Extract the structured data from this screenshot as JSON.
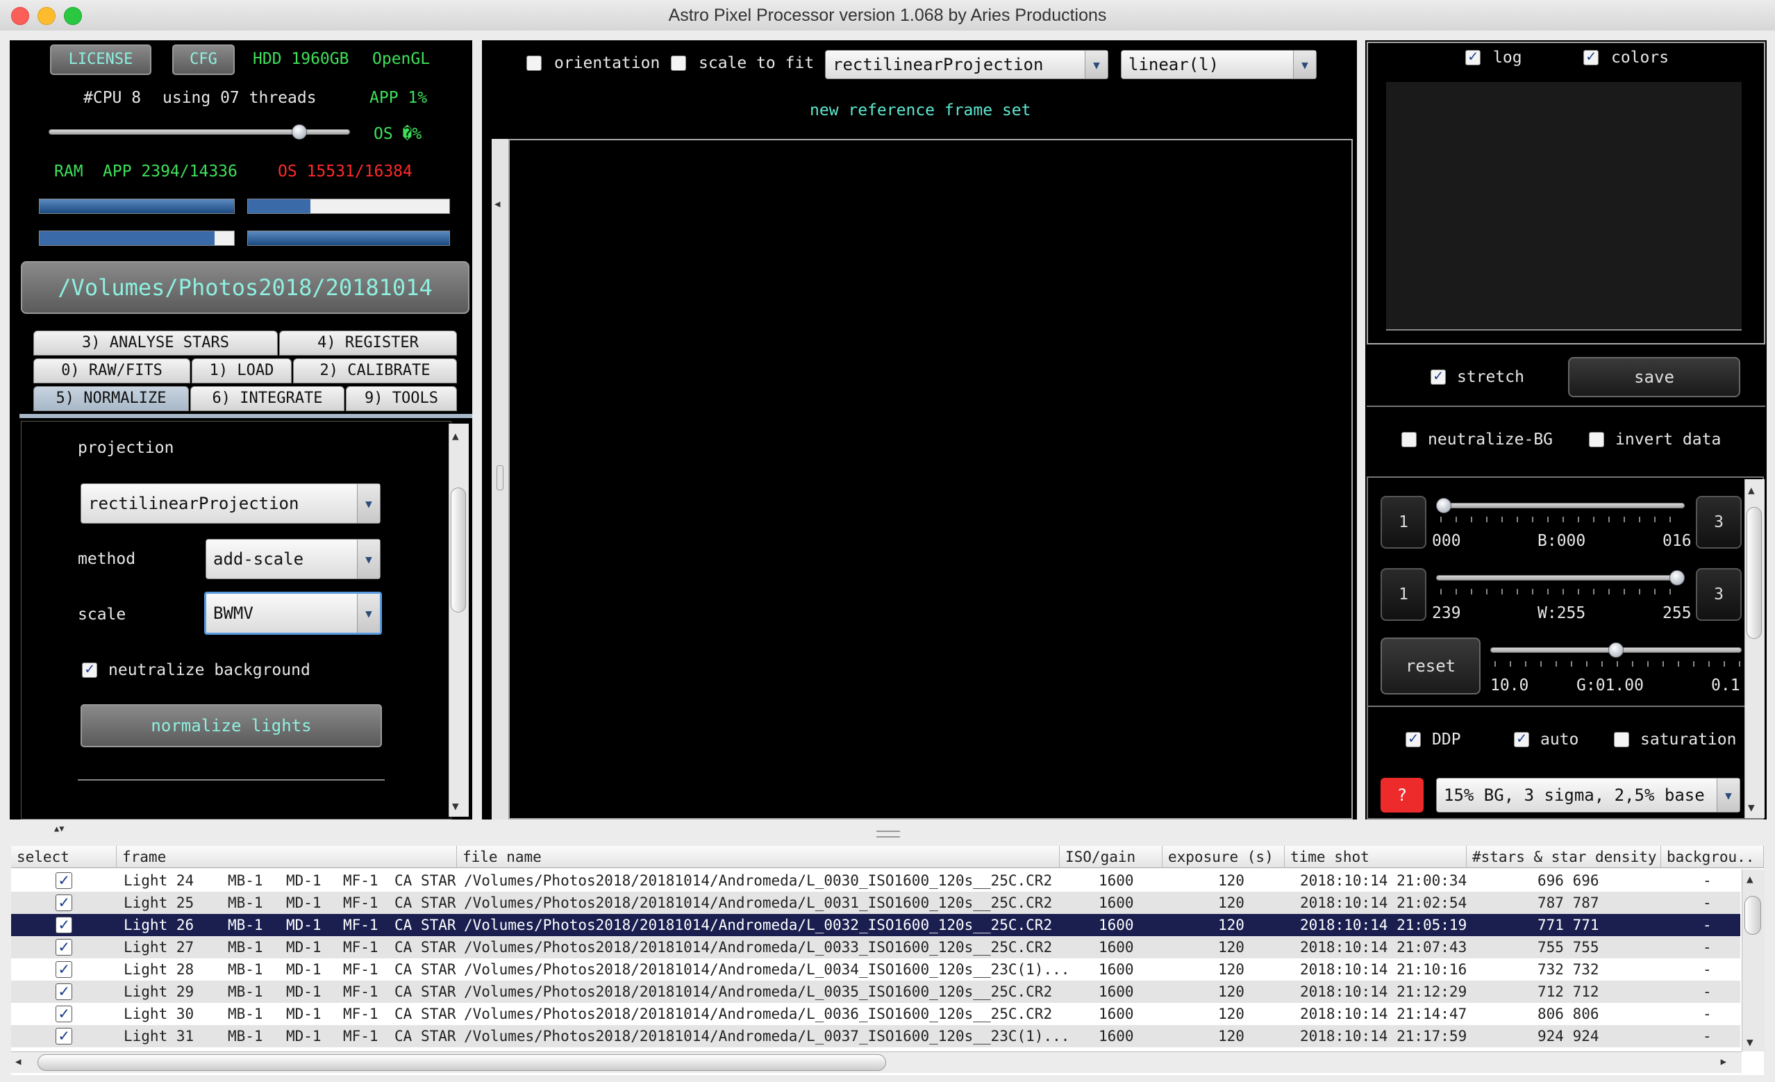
{
  "window": {
    "title": "Astro Pixel Processor version 1.068 by Aries Productions"
  },
  "sysinfo": {
    "license_label": "LICENSE",
    "cfg_label": "CFG",
    "hdd": "HDD 1960GB",
    "opengl": "OpenGL",
    "cpu": "#CPU 8",
    "threads": "using 07 threads",
    "app_cpu": "APP 1%",
    "os_cpu": "OS �%",
    "ram_label": "RAM",
    "ram_app": "APP 2394/14336",
    "ram_os": "OS 15531/16384",
    "thread_slider_fraction": 0.85
  },
  "path_button": "/Volumes/Photos2018/20181014",
  "tabs": [
    {
      "label": "3) ANALYSE STARS",
      "active": false
    },
    {
      "label": "4) REGISTER",
      "active": false
    },
    {
      "label": "0) RAW/FITS",
      "active": false
    },
    {
      "label": "1) LOAD",
      "active": false
    },
    {
      "label": "2) CALIBRATE",
      "active": false
    },
    {
      "label": "5) NORMALIZE",
      "active": true
    },
    {
      "label": "6) INTEGRATE",
      "active": false
    },
    {
      "label": "9) TOOLS",
      "active": false
    }
  ],
  "normalize": {
    "projection_label": "projection",
    "projection_value": "rectilinearProjection",
    "method_label": "method",
    "method_value": "add-scale",
    "scale_label": "scale",
    "scale_value": "BWMV",
    "neutralize_label": "neutralize background",
    "neutralize_checked": true,
    "normalize_button": "normalize lights"
  },
  "viewer": {
    "orientation_label": "orientation",
    "scale_to_fit_label": "scale to fit",
    "projection_value": "rectilinearProjection",
    "stretch_mode_value": "linear(l)",
    "status": "new reference frame set"
  },
  "histogram": {
    "log_label": "log",
    "log_checked": true,
    "colors_label": "colors",
    "colors_checked": true,
    "stretch_label": "stretch",
    "stretch_checked": true,
    "save_label": "save",
    "neutralize_bg_label": "neutralize-BG",
    "invert_label": "invert data"
  },
  "levels": {
    "black": {
      "left_btn": "1",
      "right_btn": "3",
      "min": "000",
      "center": "B:000",
      "max": "016",
      "value_fraction": 0.0
    },
    "white": {
      "left_btn": "1",
      "right_btn": "3",
      "min": "239",
      "center": "W:255",
      "max": "255",
      "value_fraction": 1.0
    },
    "gamma": {
      "reset_label": "reset",
      "min": "10.0",
      "center": "G:01.00",
      "max": "0.1",
      "value_fraction": 0.5
    },
    "ddp_label": "DDP",
    "ddp_checked": true,
    "auto_label": "auto",
    "auto_checked": true,
    "saturation_label": "saturation",
    "saturation_checked": false,
    "help_label": "?",
    "preset_value": "15% BG, 3 sigma, 2,5% base"
  },
  "table": {
    "columns": [
      "select",
      "frame",
      "file name",
      "ISO/gain",
      "exposure (s)",
      "time shot",
      "#stars & star density",
      "backgrou.."
    ],
    "rows": [
      {
        "frame": "Light 24",
        "mb": "MB-1",
        "md": "MD-1",
        "mf": "MF-1",
        "ca": "CA",
        "star": "STAR",
        "file": "/Volumes/Photos2018/20181014/Andromeda/L_0030_ISO1600_120s__25C.CR2",
        "iso": "1600",
        "exp": "120",
        "time": "2018:10:14 21:00:34",
        "stars": "696 696",
        "bg": "-"
      },
      {
        "frame": "Light 25",
        "mb": "MB-1",
        "md": "MD-1",
        "mf": "MF-1",
        "ca": "CA",
        "star": "STAR",
        "file": "/Volumes/Photos2018/20181014/Andromeda/L_0031_ISO1600_120s__25C.CR2",
        "iso": "1600",
        "exp": "120",
        "time": "2018:10:14 21:02:54",
        "stars": "787 787",
        "bg": "-"
      },
      {
        "frame": "Light 26",
        "mb": "MB-1",
        "md": "MD-1",
        "mf": "MF-1",
        "ca": "CA",
        "star": "STAR",
        "file": "/Volumes/Photos2018/20181014/Andromeda/L_0032_ISO1600_120s__25C.CR2",
        "iso": "1600",
        "exp": "120",
        "time": "2018:10:14 21:05:19",
        "stars": "771 771",
        "bg": "-"
      },
      {
        "frame": "Light 27",
        "mb": "MB-1",
        "md": "MD-1",
        "mf": "MF-1",
        "ca": "CA",
        "star": "STAR",
        "file": "/Volumes/Photos2018/20181014/Andromeda/L_0033_ISO1600_120s__25C.CR2",
        "iso": "1600",
        "exp": "120",
        "time": "2018:10:14 21:07:43",
        "stars": "755 755",
        "bg": "-"
      },
      {
        "frame": "Light 28",
        "mb": "MB-1",
        "md": "MD-1",
        "mf": "MF-1",
        "ca": "CA",
        "star": "STAR",
        "file": "/Volumes/Photos2018/20181014/Andromeda/L_0034_ISO1600_120s__23C(1)...",
        "iso": "1600",
        "exp": "120",
        "time": "2018:10:14 21:10:16",
        "stars": "732 732",
        "bg": "-"
      },
      {
        "frame": "Light 29",
        "mb": "MB-1",
        "md": "MD-1",
        "mf": "MF-1",
        "ca": "CA",
        "star": "STAR",
        "file": "/Volumes/Photos2018/20181014/Andromeda/L_0035_ISO1600_120s__25C.CR2",
        "iso": "1600",
        "exp": "120",
        "time": "2018:10:14 21:12:29",
        "stars": "712 712",
        "bg": "-"
      },
      {
        "frame": "Light 30",
        "mb": "MB-1",
        "md": "MD-1",
        "mf": "MF-1",
        "ca": "CA",
        "star": "STAR",
        "file": "/Volumes/Photos2018/20181014/Andromeda/L_0036_ISO1600_120s__25C.CR2",
        "iso": "1600",
        "exp": "120",
        "time": "2018:10:14 21:14:47",
        "stars": "806 806",
        "bg": "-"
      },
      {
        "frame": "Light 31",
        "mb": "MB-1",
        "md": "MD-1",
        "mf": "MF-1",
        "ca": "CA",
        "star": "STAR",
        "file": "/Volumes/Photos2018/20181014/Andromeda/L_0037_ISO1600_120s__23C(1)...",
        "iso": "1600",
        "exp": "120",
        "time": "2018:10:14 21:17:59",
        "stars": "924 924",
        "bg": "-"
      }
    ],
    "selected_row": 2
  },
  "colors": {
    "accent_green": "#3ee05a",
    "accent_red": "#ff2a2a",
    "accent_cyan": "#5ee8d0",
    "selection": "#1a1f50"
  }
}
